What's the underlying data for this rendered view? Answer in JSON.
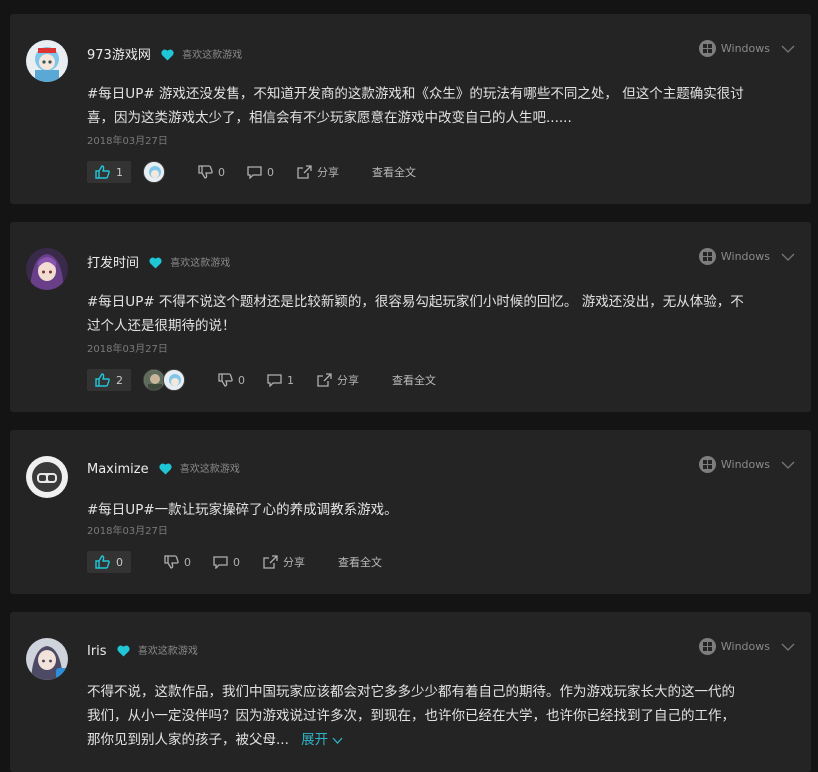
{
  "colors": {
    "accent": "#1fc6d6",
    "background": "#141414",
    "card": "#242424"
  },
  "like_tag": "喜欢这款游戏",
  "platform": "Windows",
  "share_label": "分享",
  "read_all_label": "查看全文",
  "posts": [
    {
      "user": "973游戏网",
      "text_lines": [
        "#每日UP# 游戏还没发售，不知道开发商的这款游戏和《众生》的玩法有哪些不同之处， 但这个主题确实很讨",
        "喜，因为这类游戏太少了，相信会有不少玩家愿意在游戏中改变自己的人生吧......"
      ],
      "date": "2018年03月27日",
      "up_count": "1",
      "down_count": "0",
      "comment_count": "0"
    },
    {
      "user": "打发时间",
      "text_lines": [
        "#每日UP# 不得不说这个题材还是比较新颖的，很容易勾起玩家们小时候的回忆。 游戏还没出，无从体验，不",
        "过个人还是很期待的说！"
      ],
      "date": "2018年03月27日",
      "up_count": "2",
      "down_count": "0",
      "comment_count": "1"
    },
    {
      "user": "Maximize",
      "text_lines": [
        "#每日UP#一款让玩家操碎了心的养成调教系游戏。"
      ],
      "date": "2018年03月27日",
      "up_count": "0",
      "down_count": "0",
      "comment_count": "0"
    },
    {
      "user": "Iris",
      "text_lines": [
        "不得不说，这款作品，我们中国玩家应该都会对它多多少少都有着自己的期待。作为游戏玩家长大的这一代的",
        "我们，从小一定没伴吗？因为游戏说过许多次，到现在，也许你已经在大学，也许你已经找到了自己的工作，",
        "那你见到别人家的孩子，被父母..."
      ],
      "expand_label": "展开"
    }
  ]
}
